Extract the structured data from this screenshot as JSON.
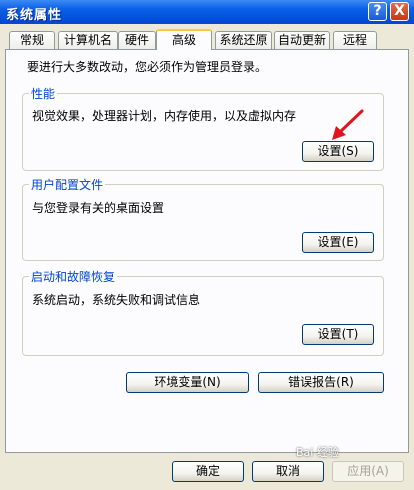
{
  "window": {
    "title": "系统属性",
    "help_glyph": "?",
    "close_glyph": "X"
  },
  "tabs": [
    {
      "label": "常规"
    },
    {
      "label": "计算机名"
    },
    {
      "label": "硬件"
    },
    {
      "label": "高级",
      "active": true
    },
    {
      "label": "系统还原"
    },
    {
      "label": "自动更新"
    },
    {
      "label": "远程"
    }
  ],
  "note": "要进行大多数改动，您必须作为管理员登录。",
  "groups": {
    "performance": {
      "title": "性能",
      "description": "视觉效果，处理器计划，内存使用，以及虚拟内存",
      "button": "设置(S)"
    },
    "user_profiles": {
      "title": "用户配置文件",
      "description": "与您登录有关的桌面设置",
      "button": "设置(E)"
    },
    "startup_recovery": {
      "title": "启动和故障恢复",
      "description": "系统启动，系统失败和调试信息",
      "button": "设置(T)"
    }
  },
  "env_button": "环境变量(N)",
  "error_report_button": "错误报告(R)",
  "footer": {
    "ok": "确定",
    "cancel": "取消",
    "apply": "应用(A)"
  },
  "watermark": "Bai 经验",
  "colors": {
    "accent_red_arrow": "#E0141E",
    "group_title": "#0046D5",
    "active_tab_highlight": "#FFC83C"
  }
}
